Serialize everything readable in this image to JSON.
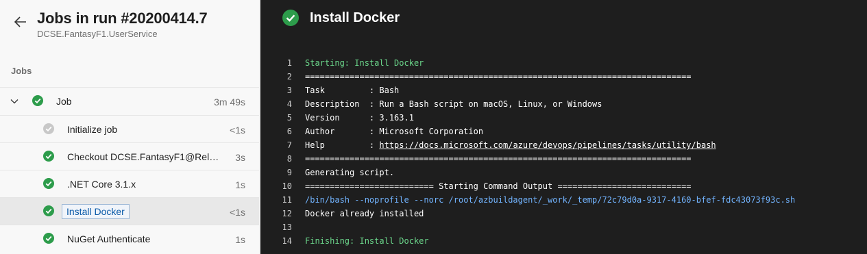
{
  "header": {
    "title": "Jobs in run #20200414.7",
    "subtitle": "DCSE.FantasyF1.UserService"
  },
  "sidebar": {
    "section_label": "Jobs",
    "job": {
      "label": "Job",
      "duration": "3m 49s"
    },
    "steps": [
      {
        "label": "Initialize job",
        "duration": "<1s",
        "status": "pending"
      },
      {
        "label": "Checkout DCSE.FantasyF1@Relea...",
        "duration": "3s",
        "status": "success"
      },
      {
        "label": ".NET Core 3.1.x",
        "duration": "1s",
        "status": "success"
      },
      {
        "label": "Install Docker",
        "duration": "<1s",
        "status": "success",
        "selected": true
      },
      {
        "label": "NuGet Authenticate",
        "duration": "1s",
        "status": "success"
      }
    ]
  },
  "log": {
    "title": "Install Docker",
    "lines": [
      {
        "n": "1",
        "text": "Starting: Install Docker"
      },
      {
        "n": "2",
        "text": "=============================================================================="
      },
      {
        "n": "3",
        "text": "Task         : Bash"
      },
      {
        "n": "4",
        "text": "Description  : Run a Bash script on macOS, Linux, or Windows"
      },
      {
        "n": "5",
        "text": "Version      : 3.163.1"
      },
      {
        "n": "6",
        "text": "Author       : Microsoft Corporation"
      },
      {
        "n": "7a",
        "text": "Help         : "
      },
      {
        "n": "7b",
        "text": "https://docs.microsoft.com/azure/devops/pipelines/tasks/utility/bash"
      },
      {
        "n": "8",
        "text": "=============================================================================="
      },
      {
        "n": "9",
        "text": "Generating script."
      },
      {
        "n": "10",
        "text": "========================== Starting Command Output ==========================="
      },
      {
        "n": "11",
        "text": "/bin/bash --noprofile --norc /root/azbuildagent/_work/_temp/72c79d0a-9317-4160-bfef-fdc43073f93c.sh"
      },
      {
        "n": "12",
        "text": "Docker already installed"
      },
      {
        "n": "14",
        "text": "Finishing: Install Docker"
      }
    ],
    "line_numbers": [
      "1",
      "2",
      "3",
      "4",
      "5",
      "6",
      "7",
      "8",
      "9",
      "10",
      "11",
      "12",
      "13",
      "14"
    ]
  },
  "colors": {
    "success": "#2d9c4b",
    "pending": "#c8c8c8",
    "log_bg": "#1e1e1e",
    "green_text": "#6cd88c",
    "blue_text": "#72b4ff"
  },
  "icons": {
    "back": "arrow-left-icon",
    "expand": "chevron-down-icon",
    "success": "check-circle-icon",
    "pending": "pending-circle-icon"
  }
}
